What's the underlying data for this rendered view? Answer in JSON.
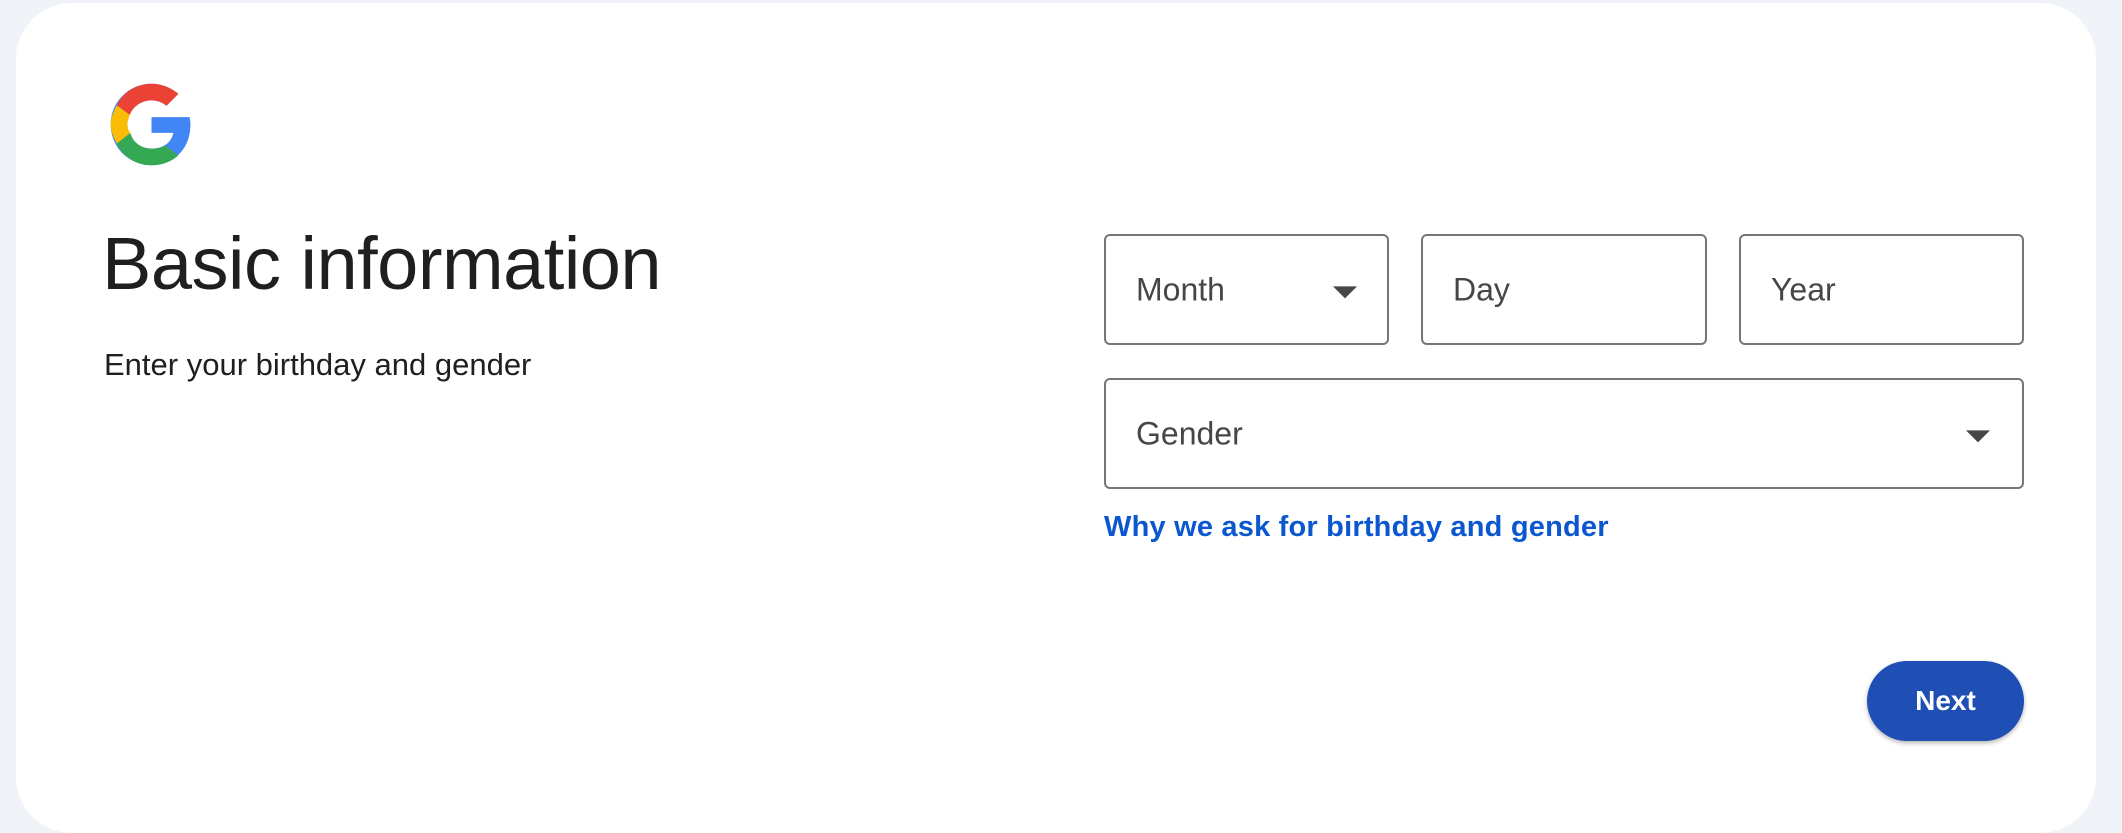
{
  "logo": {
    "icon": "google-g-logo-icon"
  },
  "header": {
    "title": "Basic information",
    "subtitle": "Enter your birthday and gender"
  },
  "birthday": {
    "month": {
      "placeholder": "Month",
      "icon": "chevron-down-icon"
    },
    "day": {
      "placeholder": "Day"
    },
    "year": {
      "placeholder": "Year"
    }
  },
  "gender": {
    "placeholder": "Gender",
    "icon": "chevron-down-icon"
  },
  "links": {
    "why": "Why we ask for birthday and gender"
  },
  "actions": {
    "next": "Next"
  },
  "colors": {
    "accent": "#0b57d0",
    "button": "#1f4fb5",
    "page_background": "#f0f4f9",
    "card_background": "#ffffff"
  }
}
